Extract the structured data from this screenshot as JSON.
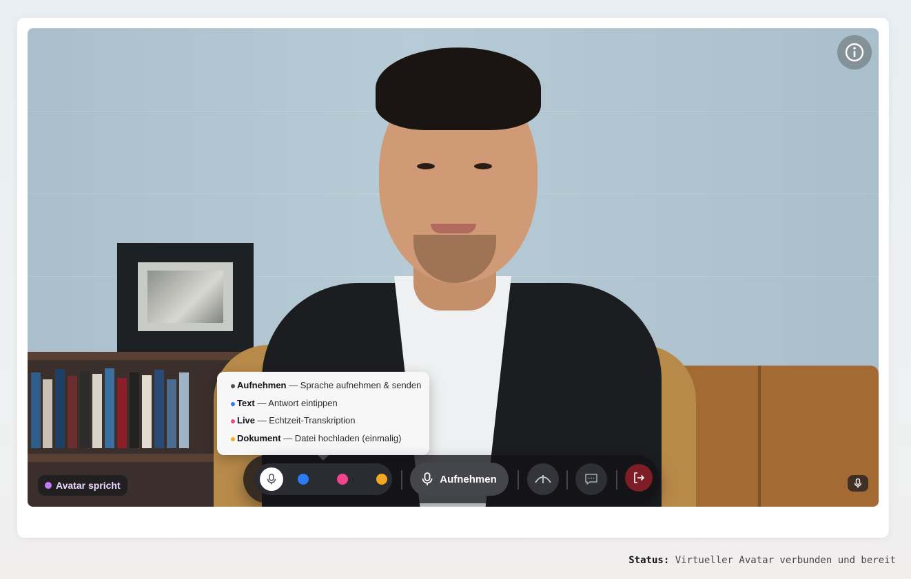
{
  "avatar": {
    "speaking_label": "Avatar spricht",
    "speaking_color": "#c27cf5"
  },
  "tooltip": {
    "items": [
      {
        "title": "Aufnehmen",
        "desc": "— Sprache aufnehmen & senden",
        "color": "#4b4f58"
      },
      {
        "title": "Text",
        "desc": "— Antwort eintippen",
        "color": "#2d7cf6"
      },
      {
        "title": "Live",
        "desc": "— Echtzeit-Transkription",
        "color": "#f0468e"
      },
      {
        "title": "Dokument",
        "desc": "— Datei hochladen (einmalig)",
        "color": "#f5a623"
      }
    ]
  },
  "toolbar": {
    "modes": [
      {
        "name": "mic",
        "icon": "mic-icon",
        "color": "#ffffff",
        "active": true
      },
      {
        "name": "text",
        "icon": "dot",
        "color": "#2d7cf6"
      },
      {
        "name": "live",
        "icon": "dot",
        "color": "#f0468e"
      },
      {
        "name": "document",
        "icon": "dot",
        "color": "#f5a623"
      }
    ],
    "record_label": "Aufnehmen",
    "exit_color": "#7e1d26"
  },
  "status": {
    "label": "Status:",
    "text": "Virtueller Avatar verbunden und bereit"
  }
}
